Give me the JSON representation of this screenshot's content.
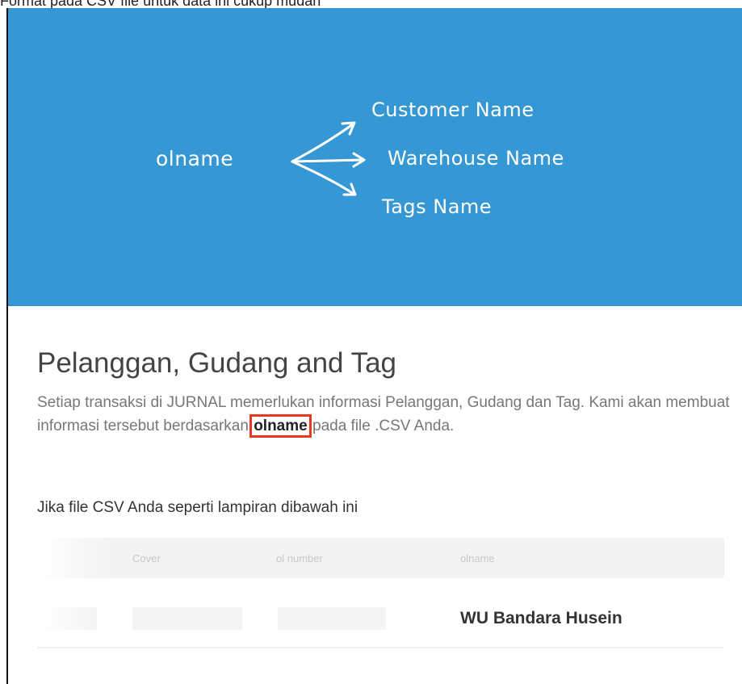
{
  "top_clip_text": "Format pada CSV file untuk data ini cukup mudah",
  "colors": {
    "hero_bg": "#3597d3",
    "highlight_border": "#e8391e",
    "text_heading": "#444444",
    "text_body": "#777777"
  },
  "hero": {
    "source": "olname",
    "targets": [
      "Customer Name",
      "Warehouse Name",
      "Tags Name"
    ],
    "icon": "branch-arrows-icon"
  },
  "section": {
    "title": "Pelanggan, Gudang and Tag",
    "description_before": "Setiap transaksi di JURNAL memerlukan informasi Pelanggan, Gudang dan Tag. Kami akan membuat informasi tersebut berdasarkan ",
    "description_keyword": "olname",
    "description_after": " pada file .CSV Anda.",
    "subheading": "Jika file CSV Anda seperti lampiran dibawah ini"
  },
  "table": {
    "headers": [
      "Cover",
      "ol number",
      "olname"
    ],
    "rows": [
      {
        "olname": "WU Bandara Husein"
      }
    ]
  }
}
